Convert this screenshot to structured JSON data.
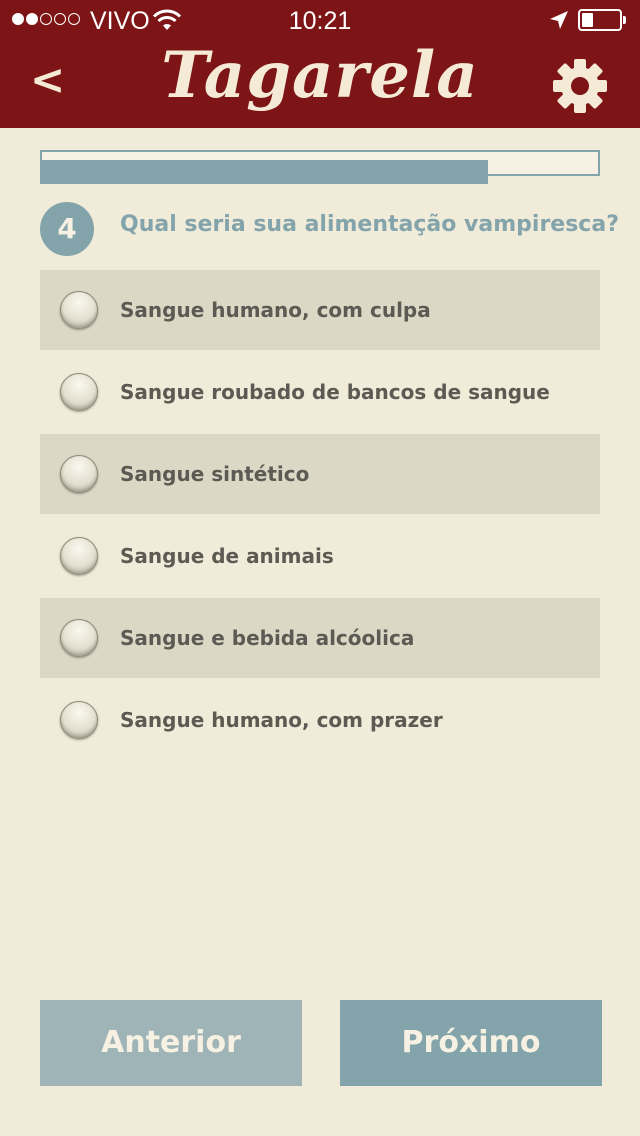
{
  "status_bar": {
    "carrier": "VIVO",
    "time": "10:21",
    "signal_bars_filled": 2,
    "signal_bars_total": 5,
    "battery_level": 0.3
  },
  "header": {
    "back_label": "<",
    "title": "Tagarela",
    "settings_icon": "gear-icon"
  },
  "quiz": {
    "progress": 0.8,
    "question_number": "4",
    "question": "Qual seria sua alimentação vampiresca?",
    "selected": null,
    "options": [
      {
        "label": "Sangue humano, com culpa"
      },
      {
        "label": "Sangue roubado de bancos de sangue"
      },
      {
        "label": "Sangue sintético"
      },
      {
        "label": "Sangue de animais"
      },
      {
        "label": "Sangue e bebida alcóolica"
      },
      {
        "label": "Sangue humano, com prazer"
      }
    ]
  },
  "footer": {
    "prev_label": "Anterior",
    "next_label": "Próximo"
  },
  "colors": {
    "header_bg": "#7d1416",
    "page_bg": "#f1ebd9",
    "accent": "#84a4ab",
    "option_shade": "#dbd9c6",
    "text": "#5c5a53"
  }
}
